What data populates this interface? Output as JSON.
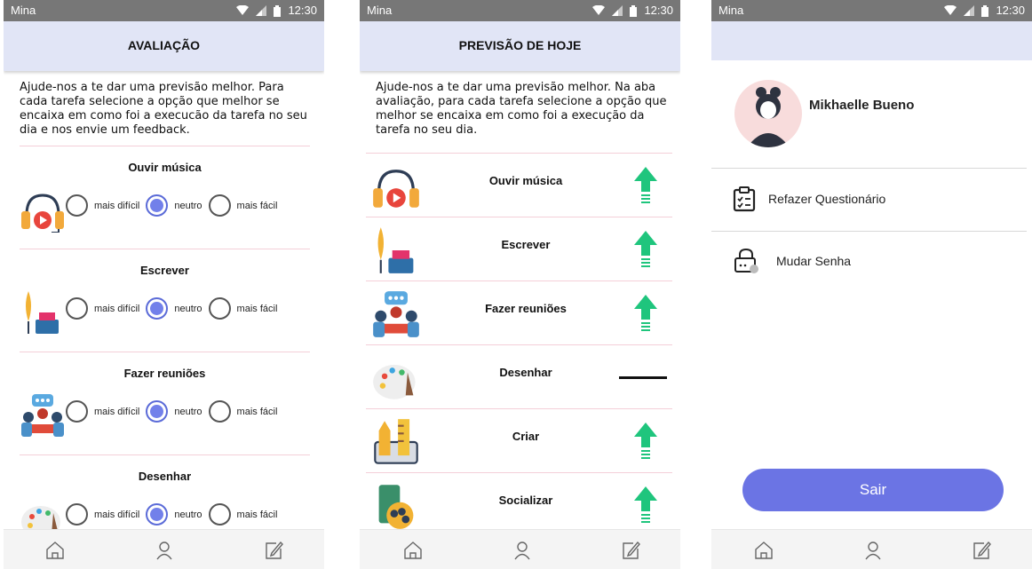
{
  "statusbar": {
    "carrier": "Mina",
    "time": "12:30"
  },
  "screen1": {
    "title": "AVALIAÇÃO",
    "intro": "Ajude-nos a te dar uma previsão melhor. Para cada tarefa selecione a opção que melhor se encaixa em como foi a execucão da tarefa no seu dia e nos envie um feedback.",
    "options": [
      "mais difícil",
      "neutro",
      "mais fácil"
    ],
    "tasks": [
      {
        "name": "Ouvir música",
        "icon": "headphones-play-icon",
        "selected": "neutro"
      },
      {
        "name": "Escrever",
        "icon": "quill-inkpot-icon",
        "selected": "neutro"
      },
      {
        "name": "Fazer reuniões",
        "icon": "meeting-icon",
        "selected": "neutro"
      },
      {
        "name": "Desenhar",
        "icon": "palette-icon",
        "selected": "neutro"
      }
    ]
  },
  "screen2": {
    "title": "PREVISÃO DE HOJE",
    "intro": "Ajude-nos a te dar uma previsão melhor. Na aba avaliação, para cada tarefa selecione a opção que melhor se encaixa em como foi a execução da tarefa no seu dia.",
    "tasks": [
      {
        "name": "Ouvir música",
        "icon": "headphones-play-icon",
        "trend": "up"
      },
      {
        "name": "Escrever",
        "icon": "quill-inkpot-icon",
        "trend": "up"
      },
      {
        "name": "Fazer reuniões",
        "icon": "meeting-icon",
        "trend": "up"
      },
      {
        "name": "Desenhar",
        "icon": "palette-icon",
        "trend": "neutral"
      },
      {
        "name": "Criar",
        "icon": "ruler-pencil-icon",
        "trend": "up"
      },
      {
        "name": "Socializar",
        "icon": "social-phone-icon",
        "trend": "up"
      }
    ]
  },
  "screen3": {
    "user_name": "Mikhaelle Bueno",
    "menu": [
      {
        "label": "Refazer Questionário",
        "icon": "clipboard-check-icon"
      },
      {
        "label": "Mudar Senha",
        "icon": "lock-icon"
      }
    ],
    "logout_label": "Sair"
  },
  "nav_icons": [
    "home-icon",
    "user-icon",
    "edit-icon"
  ],
  "colors": {
    "appbar": "#e1e5f6",
    "accent": "#6b74e4",
    "trend_up": "#1fc57d",
    "statusbar": "#777777"
  }
}
